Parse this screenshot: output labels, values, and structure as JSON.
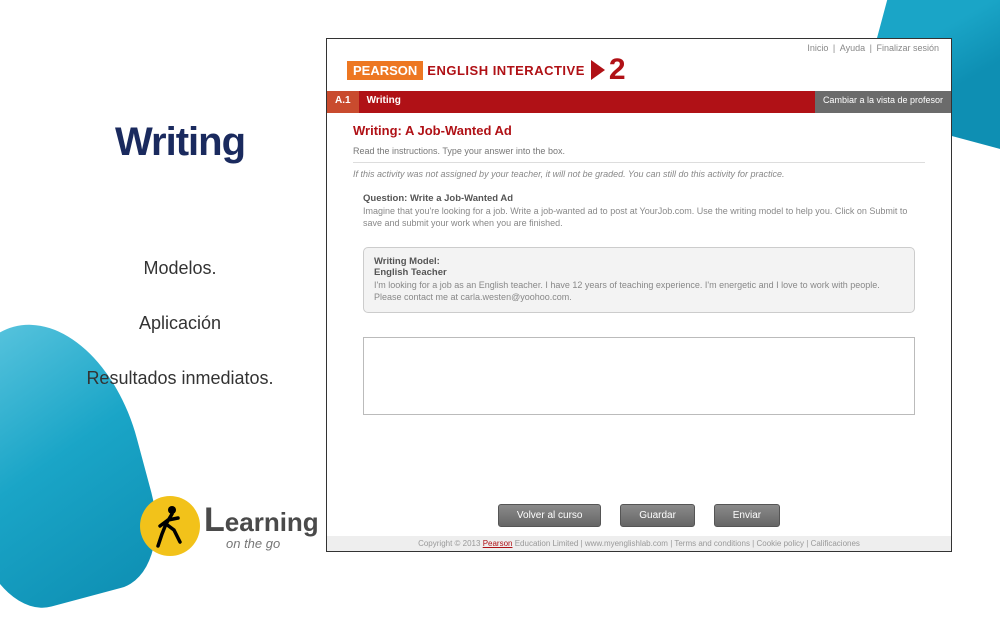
{
  "slide": {
    "title": "Writing",
    "bullets": [
      "Modelos.",
      "Aplicación",
      "Resultados inmediatos."
    ]
  },
  "logo": {
    "line1_prefix": "L",
    "line1_rest": "earning",
    "line2": "on the go"
  },
  "app": {
    "topnav": {
      "home": "Inicio",
      "help": "Ayuda",
      "logout": "Finalizar sesión"
    },
    "brand": {
      "box": "PEARSON",
      "rest": "ENGLISH INTERACTIVE",
      "level": "2"
    },
    "bar": {
      "code": "A.1",
      "section": "Writing",
      "teacher_view": "Cambiar a la vista de profesor"
    },
    "activity": {
      "title": "Writing: A Job-Wanted Ad",
      "instructions": "Read the instructions. Type your answer into the box.",
      "note": "If this activity was not assigned by your teacher, it will not be graded. You can still do this activity for practice.",
      "question_title": "Question: Write a Job-Wanted Ad",
      "question_text": "Imagine that you're looking for a job. Write a job-wanted ad to post at YourJob.com. Use the writing model to help you. Click on Submit to save and submit your work when you are finished.",
      "model_label": "Writing Model:",
      "model_heading": "English Teacher",
      "model_text": "I'm looking for a job as an English teacher. I have 12 years of teaching experience. I'm energetic and I love to work with people. Please contact me at carla.westen@yoohoo.com."
    },
    "buttons": {
      "back": "Volver al curso",
      "save": "Guardar",
      "submit": "Enviar"
    },
    "footer": {
      "copyright_prefix": "Copyright © 2013 ",
      "pearson": "Pearson",
      "rest": " Education Limited  |  www.myenglishlab.com  |  Terms and conditions  |  Cookie policy  |  Calificaciones"
    }
  }
}
